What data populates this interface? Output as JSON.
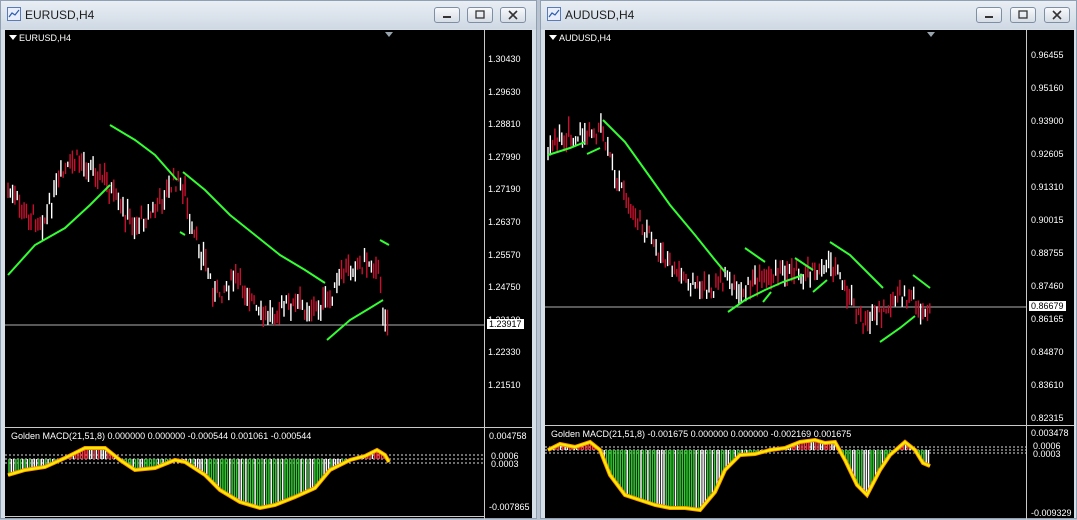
{
  "windows": [
    {
      "title": "EURUSD,H4",
      "chart_label": "EURUSD,H4",
      "price_labels": [
        "1.30430",
        "1.29630",
        "1.28810",
        "1.27990",
        "1.27190",
        "1.26370",
        "1.25570",
        "1.24750",
        "1.23130",
        "1.22330",
        "1.21510"
      ],
      "current_price": "1.23917",
      "indicator_label": "Golden MACD(21,51,8) 0.000000 0.000000 -0.000544 0.001061 -0.000544",
      "ind_scale_top": "0.004758",
      "ind_scale_mid1": "0.0006",
      "ind_scale_mid2": "0.0003",
      "ind_scale_bottom": "-0.007865"
    },
    {
      "title": "AUDUSD,H4",
      "chart_label": "AUDUSD,H4",
      "price_labels": [
        "0.96455",
        "0.95160",
        "0.93900",
        "0.92605",
        "0.91310",
        "0.90015",
        "0.88755",
        "0.87460",
        "0.86165",
        "0.84870",
        "0.83610",
        "0.82315"
      ],
      "current_price": "0.86679",
      "indicator_label": "Golden MACD(21,51,8) -0.001675 0.000000 0.000000 -0.002169 0.001675",
      "ind_scale_top": "0.003478",
      "ind_scale_mid1": "0.0006",
      "ind_scale_mid2": "0.0003",
      "ind_scale_bottom": "-0.009329"
    }
  ],
  "icons": {
    "window_icon": "chart-window-icon",
    "minimize": "minimize-icon",
    "restore": "restore-icon",
    "close": "close-icon"
  },
  "colors": {
    "bull_candle": "#ffffff",
    "bear_candle": "#c8102e",
    "trend_line": "#33ff33",
    "macd_line": "#ffee00",
    "macd_signal": "#ff9900",
    "hist_bear": "#33cc33",
    "hist_bull": "#ff3344"
  }
}
